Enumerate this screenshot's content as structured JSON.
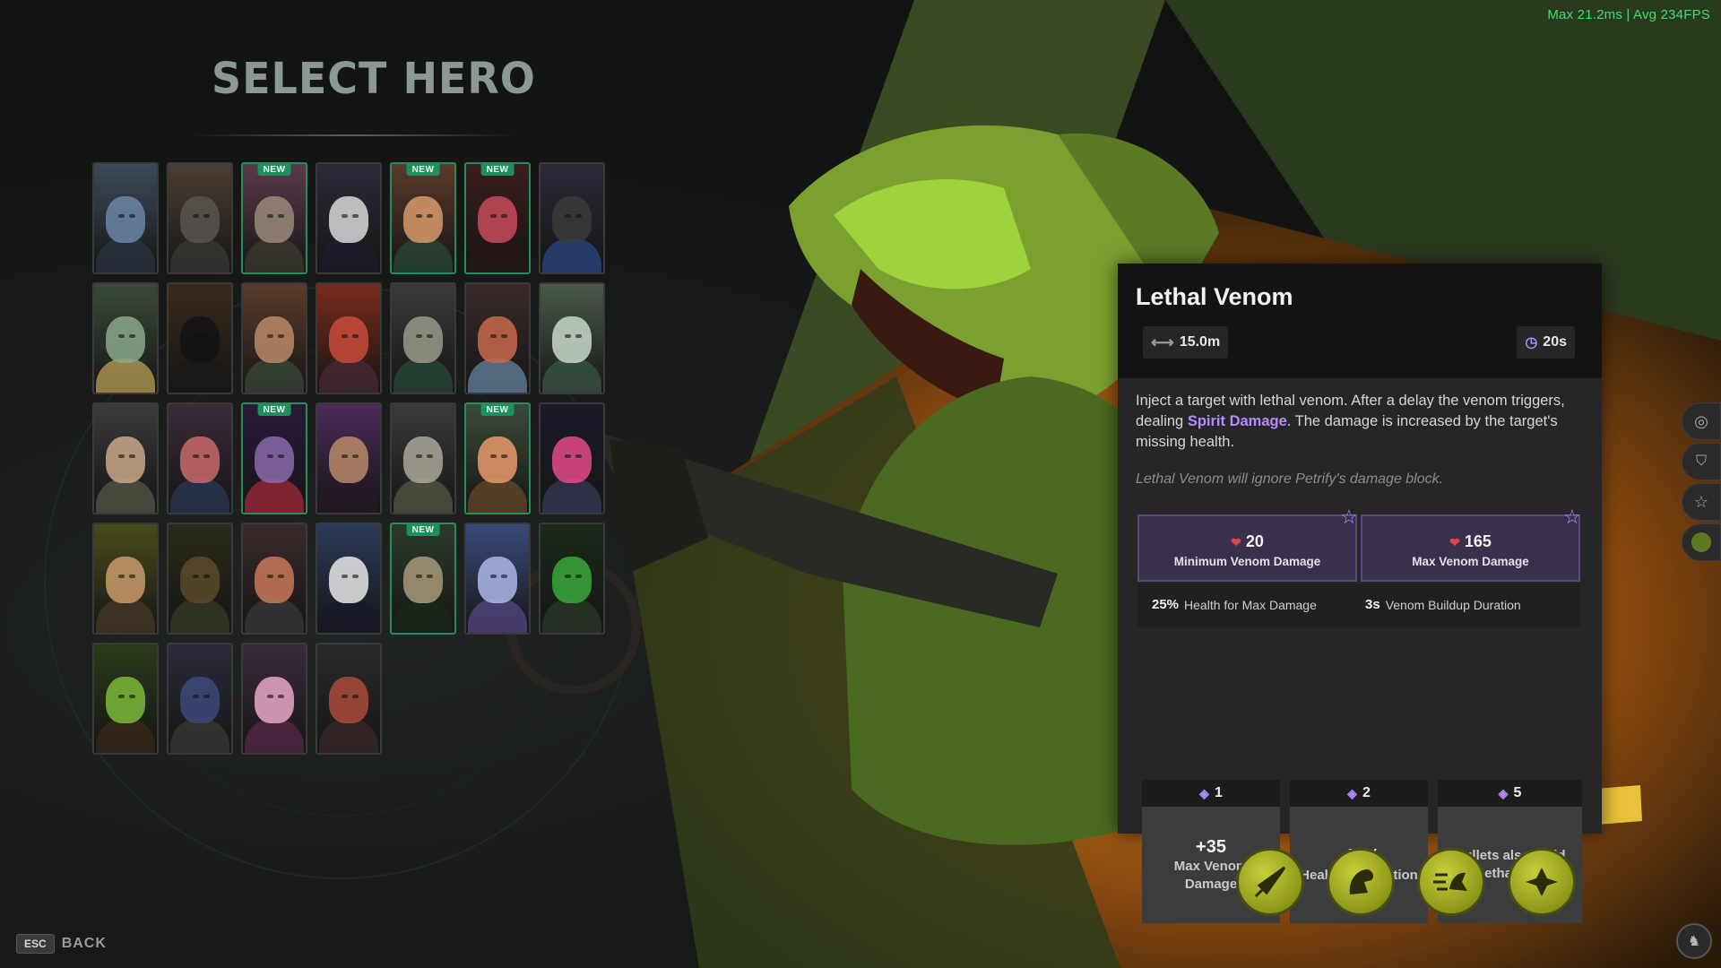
{
  "fps": "Max  21.2ms | Avg  234FPS",
  "title": "SELECT HERO",
  "heroes": [
    {
      "new": false,
      "bg": "#3d4a58",
      "face": "#6a86a8",
      "body": "#2b3442"
    },
    {
      "new": false,
      "bg": "#4a3d33",
      "face": "#5a5550",
      "body": "#3a3a38"
    },
    {
      "new": true,
      "bg": "#5a3a4a",
      "face": "#9a8a7a",
      "body": "#3e3a30"
    },
    {
      "new": false,
      "bg": "#2a2a3a",
      "face": "#d8d8d8",
      "body": "#1e1e2e"
    },
    {
      "new": true,
      "bg": "#5a3a2a",
      "face": "#d89a6a",
      "body": "#2a4a3a"
    },
    {
      "new": true,
      "bg": "#3a1e1e",
      "face": "#c84a5a",
      "body": "#2a1818"
    },
    {
      "new": false,
      "bg": "#2a2a3a",
      "face": "#3a3a3a",
      "body": "#2a4a8a"
    },
    {
      "new": false,
      "bg": "#3a4a3a",
      "face": "#8aa88a",
      "body": "#c8a85a"
    },
    {
      "new": false,
      "bg": "#3a2a1a",
      "face": "#141414",
      "body": "#1a1a1a"
    },
    {
      "new": false,
      "bg": "#5a3a2a",
      "face": "#b88a6a",
      "body": "#3a4a3a"
    },
    {
      "new": false,
      "bg": "#7a2a1a",
      "face": "#c84a3a",
      "body": "#4a2a3a"
    },
    {
      "new": false,
      "bg": "#3a3a3a",
      "face": "#9a9a8a",
      "body": "#2a4a3a"
    },
    {
      "new": false,
      "bg": "#3a2a2a",
      "face": "#c86a4a",
      "body": "#6a8aaa"
    },
    {
      "new": false,
      "bg": "#4a5a4a",
      "face": "#c8d8c8",
      "body": "#3a5a4a"
    },
    {
      "new": false,
      "bg": "#3a3a3a",
      "face": "#c8a88a",
      "body": "#5a5a4a"
    },
    {
      "new": false,
      "bg": "#3a2a3a",
      "face": "#c86a6a",
      "body": "#2a3a5a"
    },
    {
      "new": true,
      "bg": "#2a1a3a",
      "face": "#8a6aaa",
      "body": "#aa2a3a"
    },
    {
      "new": false,
      "bg": "#4a2a5a",
      "face": "#b88a6a",
      "body": "#2a1a2a"
    },
    {
      "new": false,
      "bg": "#3a3a3a",
      "face": "#aaa89a",
      "body": "#5a5a4a"
    },
    {
      "new": true,
      "bg": "#3a4a3a",
      "face": "#e89a6a",
      "body": "#6a4a2a"
    },
    {
      "new": false,
      "bg": "#1a1a2a",
      "face": "#e84a8a",
      "body": "#3a3a5a"
    },
    {
      "new": false,
      "bg": "#4a4a1a",
      "face": "#c89a6a",
      "body": "#4a3a2a"
    },
    {
      "new": false,
      "bg": "#2a2a1a",
      "face": "#5a4a2a",
      "body": "#3a3a2a"
    },
    {
      "new": false,
      "bg": "#3a2a2a",
      "face": "#c8785a",
      "body": "#3a3a3a"
    },
    {
      "new": false,
      "bg": "#2a3a5a",
      "face": "#e8e8e8",
      "body": "#1a1a2a"
    },
    {
      "new": true,
      "bg": "#2a3a2a",
      "face": "#a89a7a",
      "body": "#1a2a1a"
    },
    {
      "new": false,
      "bg": "#3a4a7a",
      "face": "#aab8e8",
      "body": "#5a4a8a"
    },
    {
      "new": false,
      "bg": "#1a2a1a",
      "face": "#3aa83a",
      "body": "#2a3a2a"
    },
    {
      "new": false,
      "bg": "#2a3a1a",
      "face": "#7aba3a",
      "body": "#3a2a1a"
    },
    {
      "new": false,
      "bg": "#2a2a3a",
      "face": "#3a4a7a",
      "body": "#3a3a3a"
    },
    {
      "new": false,
      "bg": "#3a2a3a",
      "face": "#e8a8c8",
      "body": "#5a2a4a"
    },
    {
      "new": false,
      "bg": "#2a2a2a",
      "face": "#aa4a3a",
      "body": "#3a2a2a"
    }
  ],
  "new_label": "NEW",
  "back": {
    "key": "ESC",
    "label": "BACK"
  },
  "ability": {
    "name": "Lethal Venom",
    "range": "15.0m",
    "cooldown": "20s",
    "desc_1": "Inject a target with lethal venom. After a delay the venom triggers, dealing ",
    "desc_highlight": "Spirit Damage",
    "desc_2": ". The damage is increased by the target's missing health.",
    "note": "Lethal Venom will ignore Petrify's damage block.",
    "min_value": "20",
    "min_label": "Minimum Venom Damage",
    "max_value": "165",
    "max_label": "Max Venom Damage",
    "extra_a_value": "25%",
    "extra_a_label": "Health for Max Damage",
    "extra_b_value": "3s",
    "extra_b_label": "Venom Buildup Duration",
    "upgrades": [
      {
        "tier": "1",
        "big": "+35",
        "small": "Max Venom Damage"
      },
      {
        "tier": "2",
        "big": "-40%",
        "small": "Healing Reduction"
      },
      {
        "tier": "5",
        "big": "",
        "small": "Bullets also build up Lethal Venom"
      }
    ]
  },
  "colors": {
    "accent_purple": "#b78bff",
    "venom_box": "#3b2f4e",
    "new_badge": "#1f8f5c",
    "ability_button": "#a5ae24"
  },
  "icons": {
    "range": "double-arrow-icon",
    "cooldown": "clock-icon",
    "ability_buttons": [
      "dart-icon",
      "lizard-leap-icon",
      "dash-icon",
      "petrify-icon"
    ],
    "side_tabs": [
      "target-icon",
      "shield-icon",
      "star-icon",
      "hero-portrait-icon"
    ]
  }
}
